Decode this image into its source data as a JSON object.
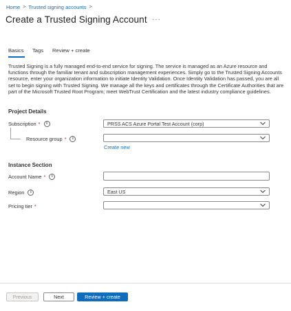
{
  "breadcrumb": {
    "home": "Home",
    "sep": ">",
    "accounts": "Trusted signing accounts"
  },
  "page": {
    "title": "Create a Trusted Signing Account",
    "more": "···"
  },
  "tabs": [
    {
      "label": "Basics"
    },
    {
      "label": "Tags"
    },
    {
      "label": "Review + create"
    }
  ],
  "description": "Trusted Signing is a fully managed end-to-end service for signing. The service is managed as an Azure resource and functions through the familiar tenant and subscription management experiences. Simply go to the Trusted Signing Accounts resource, enter your organization information to initiate Identity Validation. Once Identity Validation has passed, you are all set to begin signing with Trusted Signing. We manage all the keys and certificates through the Certificate Authorities that are part of the Microsoft Trusted Root Program; meet WebTrust Certification and the latest industry compliance guidelines.",
  "project_details": {
    "heading": "Project Details",
    "subscription": {
      "label": "Subscription",
      "required": "*",
      "value": "PRSS ACS Azure Portal Test Account (corp)"
    },
    "resource_group": {
      "label": "Resource group",
      "required": "*",
      "value": "",
      "create_new": "Create new"
    }
  },
  "instance": {
    "heading": "Instance Section",
    "account_name": {
      "label": "Account Name",
      "required": "*",
      "value": ""
    },
    "region": {
      "label": "Region",
      "value": "East US"
    },
    "pricing_tier": {
      "label": "Pricing tier",
      "required": "*",
      "value": ""
    }
  },
  "footer": {
    "previous": "Previous",
    "next": "Next",
    "review_create": "Review + create"
  },
  "icons": {
    "info": "i"
  },
  "colors": {
    "accent": "#0f6cbd",
    "required": "#a4262c"
  }
}
